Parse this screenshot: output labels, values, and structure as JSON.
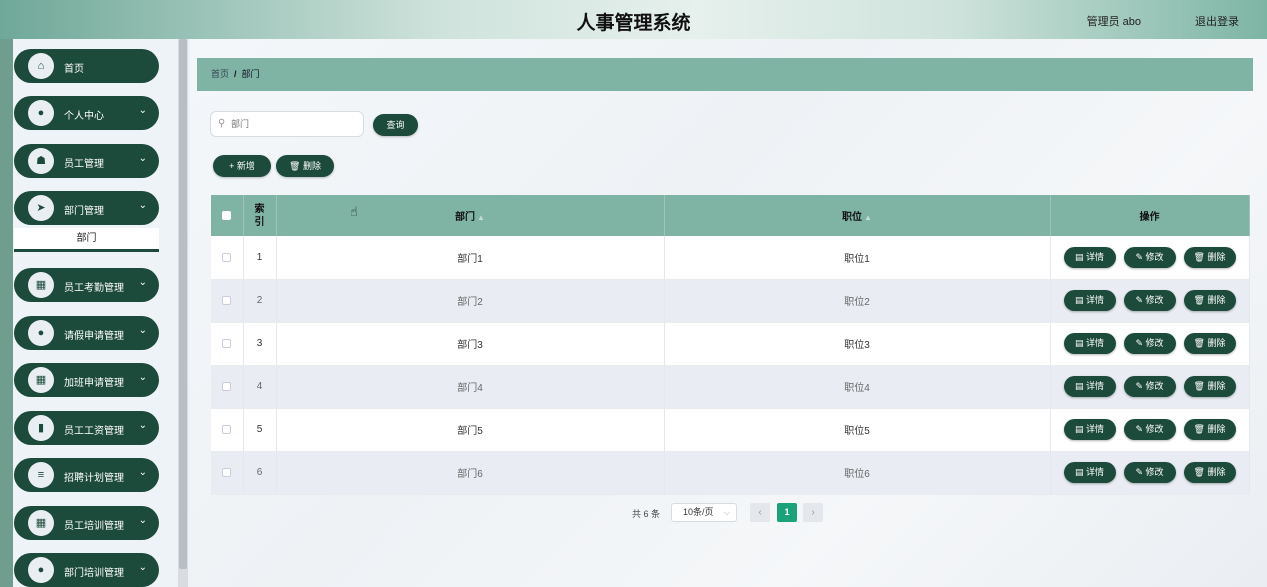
{
  "header": {
    "title": "人事管理系统",
    "user": "管理员 abo",
    "logout": "退出登录"
  },
  "sidebar": {
    "items": [
      {
        "label": "首页",
        "icon": "home-icon",
        "glyph": "⌂",
        "has_chevron": false
      },
      {
        "label": "个人中心",
        "icon": "user-icon",
        "glyph": "●",
        "has_chevron": true
      },
      {
        "label": "员工管理",
        "icon": "thumb-icon",
        "glyph": "☗",
        "has_chevron": true
      },
      {
        "label": "部门管理",
        "icon": "send-icon",
        "glyph": "➤",
        "has_chevron": true
      },
      {
        "label": "员工考勤管理",
        "icon": "grid-icon",
        "glyph": "▦",
        "has_chevron": true
      },
      {
        "label": "请假申请管理",
        "icon": "person-icon",
        "glyph": "●",
        "has_chevron": true
      },
      {
        "label": "加班申请管理",
        "icon": "grid-icon",
        "glyph": "▦",
        "has_chevron": true
      },
      {
        "label": "员工工资管理",
        "icon": "bar-chart-icon",
        "glyph": "▮",
        "has_chevron": true
      },
      {
        "label": "招聘计划管理",
        "icon": "list-icon",
        "glyph": "≡",
        "has_chevron": true
      },
      {
        "label": "员工培训管理",
        "icon": "grid-icon",
        "glyph": "▦",
        "has_chevron": true
      },
      {
        "label": "部门培训管理",
        "icon": "person-icon",
        "glyph": "●",
        "has_chevron": true
      }
    ],
    "submenu_active": "部门"
  },
  "breadcrumb": {
    "home": "首页",
    "sep": "/",
    "current": "部门"
  },
  "search": {
    "placeholder": "部门",
    "button": "查询"
  },
  "actions": {
    "add": "+ 新增",
    "delete": "🗑 删除"
  },
  "table": {
    "headers": [
      "索引",
      "部门",
      "职位",
      "操作"
    ],
    "rows": [
      {
        "index": "1",
        "dept": "部门1",
        "position": "职位1"
      },
      {
        "index": "2",
        "dept": "部门2",
        "position": "职位2"
      },
      {
        "index": "3",
        "dept": "部门3",
        "position": "职位3"
      },
      {
        "index": "4",
        "dept": "部门4",
        "position": "职位4"
      },
      {
        "index": "5",
        "dept": "部门5",
        "position": "职位5"
      },
      {
        "index": "6",
        "dept": "部门6",
        "position": "职位6"
      }
    ],
    "row_actions": {
      "detail": "详情",
      "edit": "修改",
      "delete": "删除"
    }
  },
  "pagination": {
    "total": "共 6 条",
    "page_size": "10条/页",
    "prev": "‹",
    "current": "1",
    "next": "›"
  },
  "colors": {
    "dark_green": "#1c4a3b",
    "header_teal": "#7fb3a4",
    "pager_active": "#1aa37a"
  }
}
